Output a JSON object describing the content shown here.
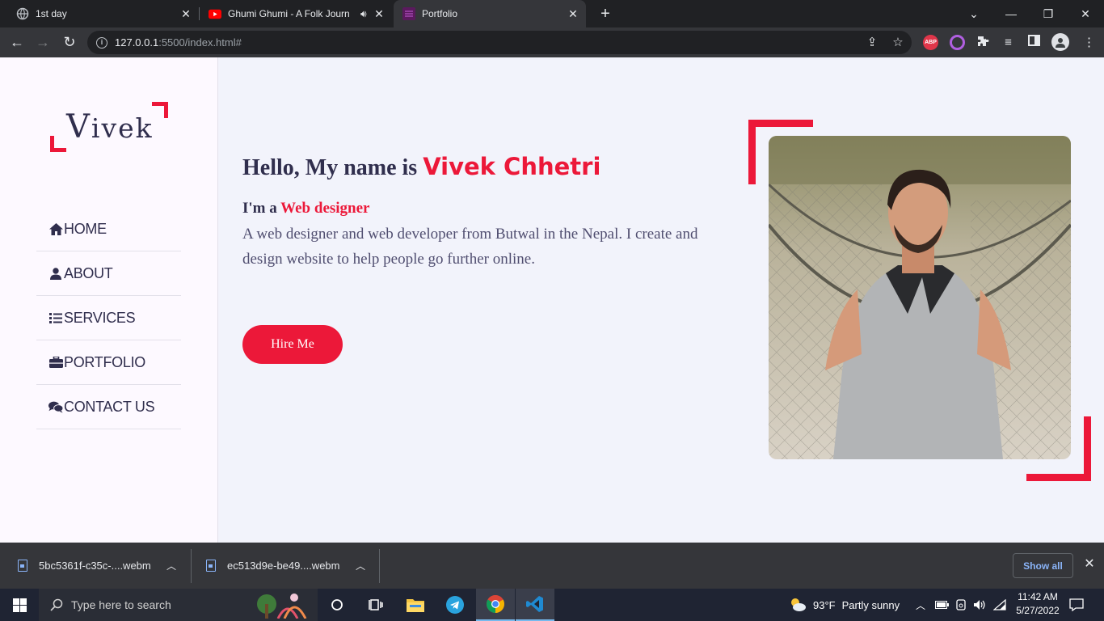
{
  "browser": {
    "tabs": [
      {
        "title": "1st day",
        "active": false
      },
      {
        "title": "Ghumi Ghumi - A Folk Journ",
        "active": false
      },
      {
        "title": "Portfolio",
        "active": true
      }
    ],
    "url_host": "127.0.0.1",
    "url_rest": ":5500/index.html#",
    "extensions": {
      "adblock_label": "ABP"
    }
  },
  "site": {
    "logo_initial": "V",
    "logo_rest": "ivek",
    "nav": [
      {
        "label": "HOME",
        "icon": "home-icon"
      },
      {
        "label": "ABOUT",
        "icon": "user-icon"
      },
      {
        "label": "SERVICES",
        "icon": "list-icon"
      },
      {
        "label": "PORTFOLIO",
        "icon": "briefcase-icon"
      },
      {
        "label": "CONTACT US",
        "icon": "comments-icon"
      }
    ],
    "hero": {
      "greeting": "Hello, My name is ",
      "name": "Vivek Chhetri",
      "role_prefix": "I'm a ",
      "role": "Web designer",
      "description": "A web designer and web developer from Butwal in the Nepal. I create and design website to help people go further online.",
      "button": "Hire Me"
    },
    "accent_color": "#ec1839",
    "text_color": "#302e4d"
  },
  "downloads": {
    "items": [
      {
        "name": "5bc5361f-c35c-....webm"
      },
      {
        "name": "ec513d9e-be49....webm"
      }
    ],
    "show_all": "Show all"
  },
  "taskbar": {
    "search_placeholder": "Type here to search",
    "weather_temp": "93°F",
    "weather_text": "Partly sunny",
    "time": "11:42 AM",
    "date": "5/27/2022"
  }
}
